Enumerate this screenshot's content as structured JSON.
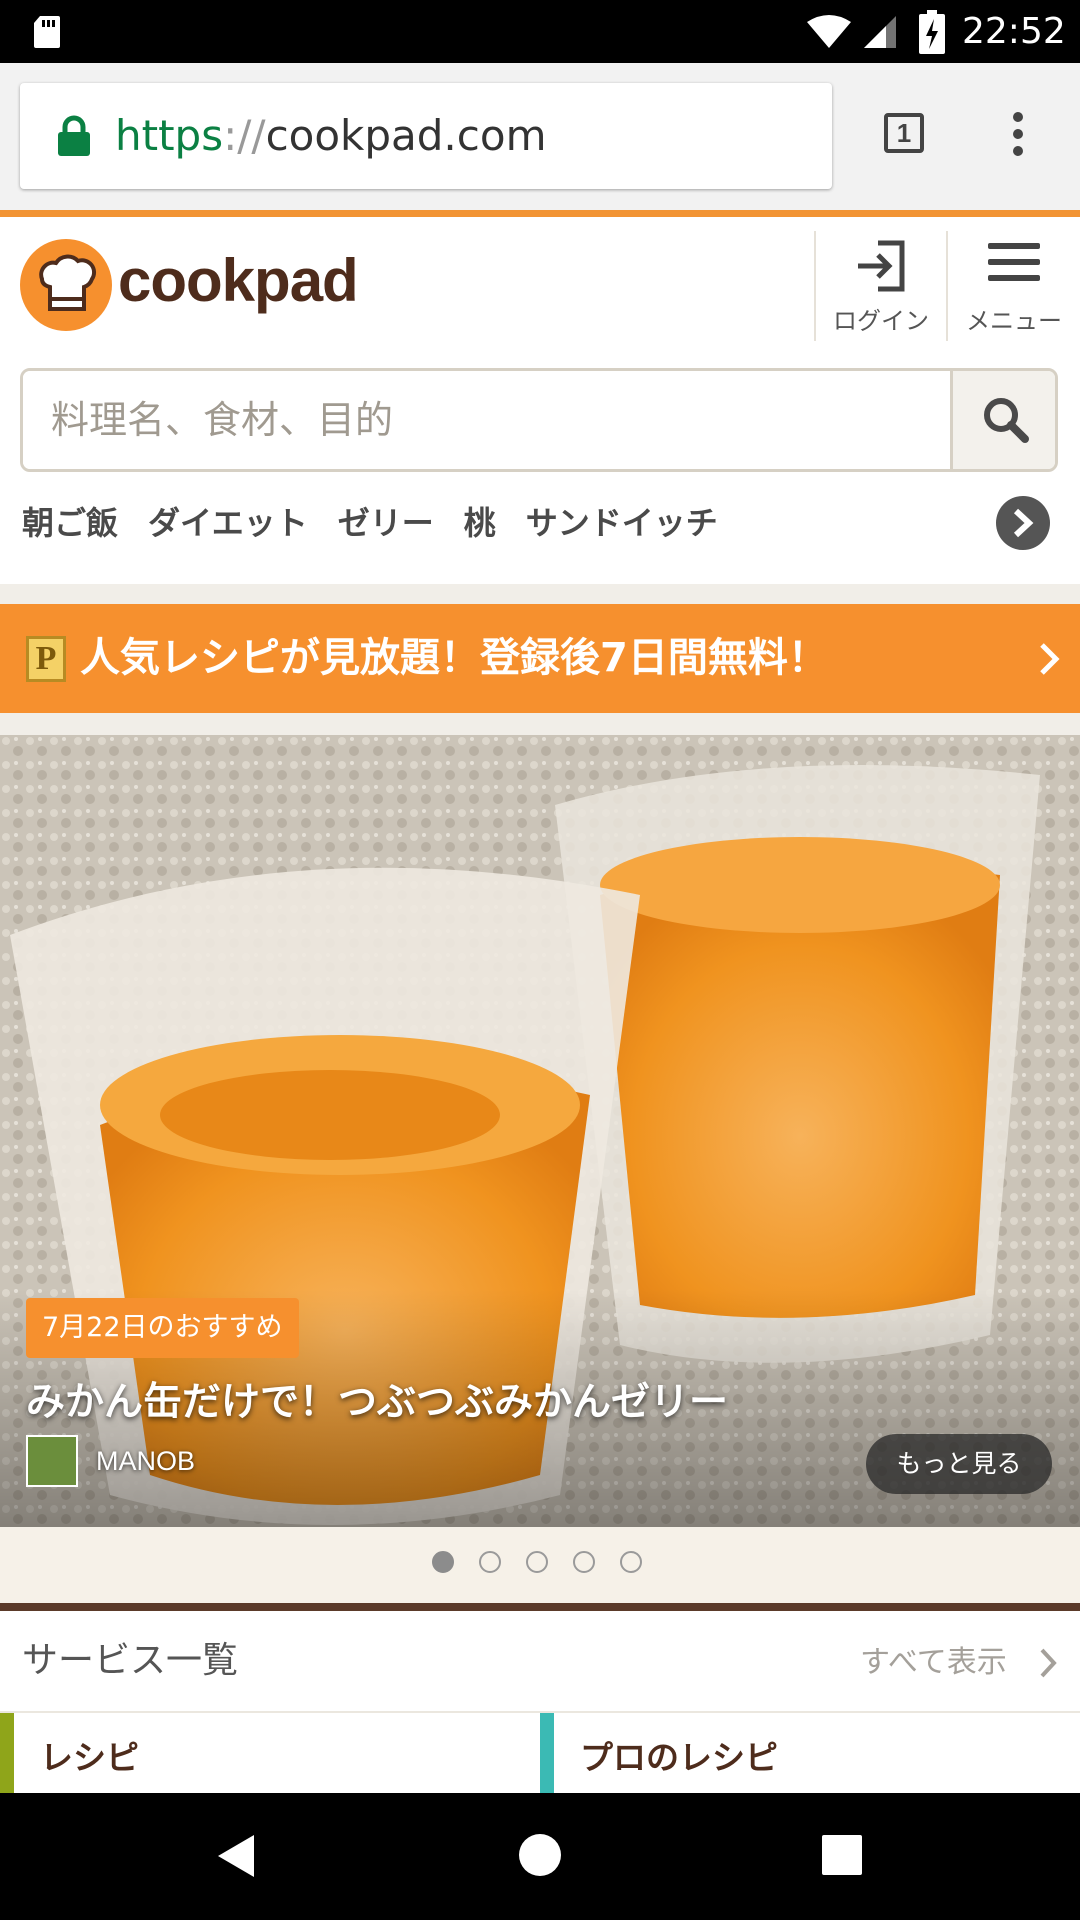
{
  "status_bar": {
    "time": "22:52"
  },
  "browser": {
    "url_scheme": "https",
    "url_sep": "://",
    "url_host": "cookpad.com",
    "tab_count": "1"
  },
  "header": {
    "logo_text": "cookpad",
    "login_label": "ログイン",
    "menu_label": "メニュー"
  },
  "search": {
    "placeholder": "料理名、食材、目的"
  },
  "keywords": [
    "朝ご飯",
    "ダイエット",
    "ゼリー",
    "桃",
    "サンドイッチ"
  ],
  "promo": {
    "badge": "P",
    "text": "人気レシピが見放題！登録後7日間無料！"
  },
  "hero": {
    "date_badge": "7月22日のおすすめ",
    "title": "みかん缶だけで！つぶつぶみかんゼリー",
    "author": "MANOB",
    "more_label": "もっと見る",
    "slide_count": 5,
    "active_slide": 1
  },
  "services": {
    "title": "サービス一覧",
    "show_all": "すべて表示",
    "items": [
      {
        "label": "レシピ",
        "accent": "#8fa51a"
      },
      {
        "label": "プロのレシピ",
        "accent": "#3bbab4"
      }
    ]
  },
  "colors": {
    "brand_orange": "#f6902e",
    "brand_brown": "#4e2c1c",
    "lock_green": "#0b8043"
  }
}
